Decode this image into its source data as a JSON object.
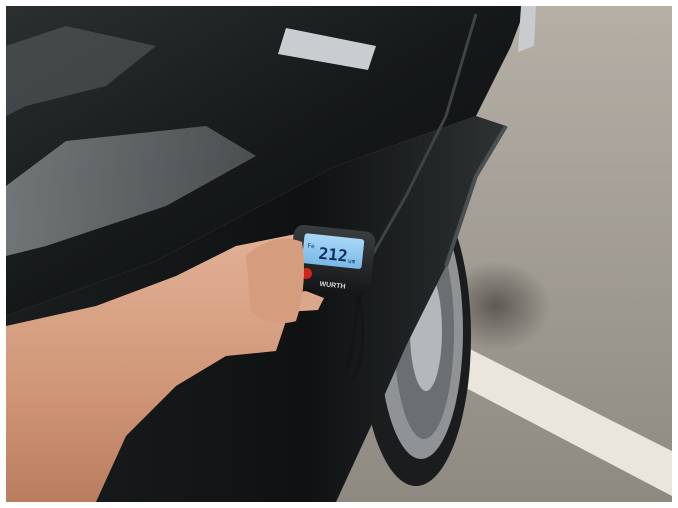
{
  "gauge": {
    "reading": "212",
    "unit": "um",
    "mode_mark": "Fe",
    "brand": "WURTH"
  },
  "colors": {
    "paint": "#1c1f20",
    "floor": "#9a958c",
    "floor_line": "#e9e6de",
    "lcd": "#8fc9f0",
    "lcd_text": "#0f2d63",
    "skin": "#d79f81"
  }
}
